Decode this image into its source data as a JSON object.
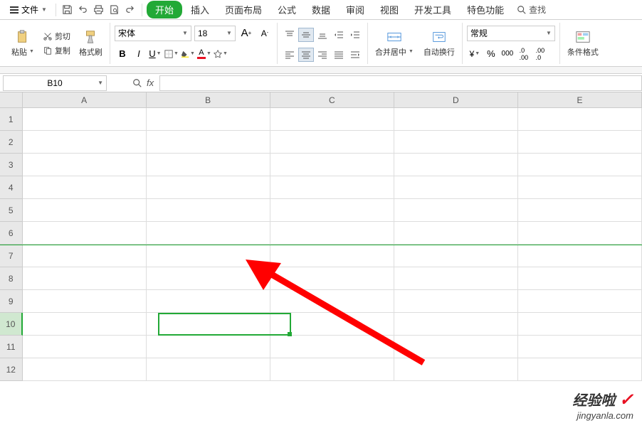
{
  "menu": {
    "file_label": "文件",
    "tabs": [
      "开始",
      "插入",
      "页面布局",
      "公式",
      "数据",
      "审阅",
      "视图",
      "开发工具",
      "特色功能"
    ],
    "active_tab": 0,
    "search_label": "查找"
  },
  "ribbon": {
    "clipboard": {
      "paste": "粘贴",
      "cut": "剪切",
      "copy": "复制",
      "format_painter": "格式刷"
    },
    "font": {
      "name": "宋体",
      "size": "18"
    },
    "merge": "合并居中",
    "wrap": "自动换行",
    "number_format": "常规",
    "cond_format": "条件格式"
  },
  "formula_bar": {
    "cell_ref": "B10",
    "formula": ""
  },
  "grid": {
    "cols": [
      "A",
      "B",
      "C",
      "D",
      "E"
    ],
    "rows": [
      "1",
      "2",
      "3",
      "4",
      "5",
      "6",
      "7",
      "8",
      "9",
      "10",
      "11",
      "12"
    ],
    "selected_row": "10",
    "freeze_after_row": 6,
    "selected_cell": "B10"
  },
  "watermark": {
    "line1": "经验啦",
    "line2": "jingyanla.com"
  }
}
